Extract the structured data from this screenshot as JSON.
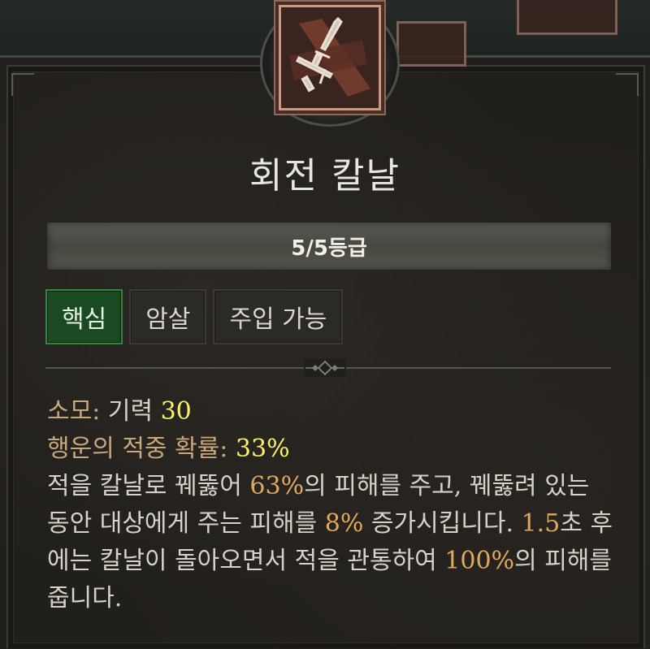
{
  "skill": {
    "name": "회전 칼날",
    "rank": "5/5등급",
    "icon": "crossed-daggers-icon"
  },
  "tags": [
    "핵심",
    "암살",
    "주입 가능"
  ],
  "stats": {
    "cost_label": "소모: ",
    "cost_value_label": "기력 ",
    "cost_value": "30",
    "crit_label": "행운의 적중 확률: ",
    "crit_value": "33%"
  },
  "description": {
    "p1": "적을 칼날로 꿰뚫어 ",
    "v1": "63%",
    "p2": "의 피해를 주고, 꿰뚫려 있는 동안 대상에게 주는 피해를 ",
    "v2": "8%",
    "p3": " 증가시킵니다. ",
    "v3": "1.5",
    "p4": "초 후에는 칼날이 돌아오면서 적을 관통하여 ",
    "v4": "100%",
    "p5": "의 피해를 줍니다."
  },
  "colors": {
    "label_gold": "#c8a77a",
    "value_yellow": "#fbf06a",
    "value_orange": "#e0a95e",
    "core_tag_green": "#1a4a22"
  }
}
